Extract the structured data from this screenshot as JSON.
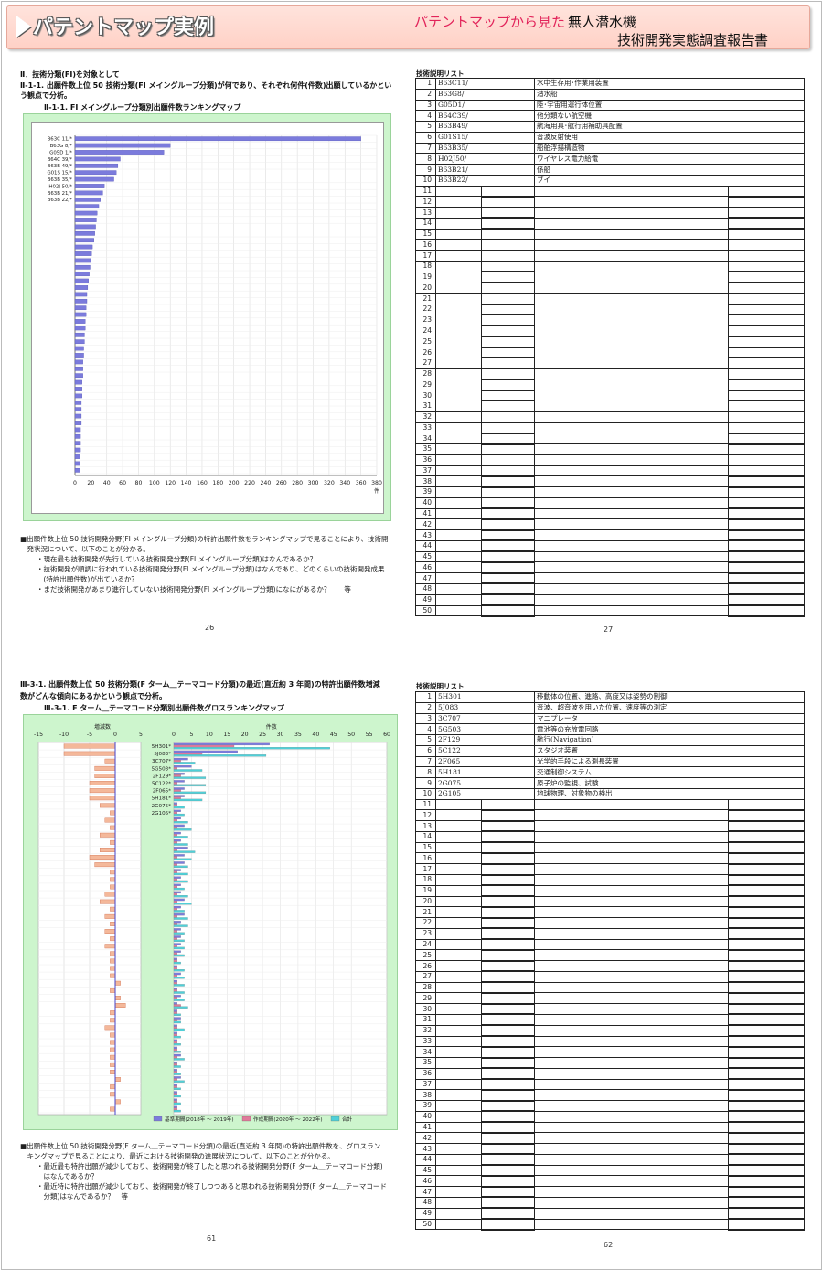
{
  "header": {
    "title": "パテントマップ実例",
    "subtitle_pink": "パテントマップから見た",
    "right_line1": "無人潜水機",
    "right_line2": "技術開発実態調査報告書"
  },
  "top_left": {
    "heading1": "Ⅱ．技術分類(FI)を対象として",
    "heading2_line1": "Ⅱ-1-1. 出願件数上位 50 技術分類(FI メイングループ分類)が何であり、それぞれ何件(件数)出願しているかとい",
    "heading2_line2": "う観点で分析。",
    "chart_caption": "Ⅱ-1-1. FI メイングループ分類別出願件数ランキングマップ",
    "note_lines": [
      "■出願件数上位 50 技術開発分野(FI メイングループ分類)の特許出願件数をランキングマップで見ることにより、技術開",
      "　発状況について、以下のことが分かる。",
      "・現在最も技術開発が先行している技術開発分野(FI メイングループ分類)はなんであるか？",
      "・技術開発が順調に行われている技術開発分野(FI メイングループ分類)はなんであり、どのくらいの技術開発成果",
      "　(特許出願件数)が出ているか？",
      "・まだ技術開発があまり進行していない技術開発分野(FI メイングループ分類)になにがあるか？　　等"
    ],
    "page": "26"
  },
  "top_right": {
    "label": "技術説明リスト",
    "rows": [
      {
        "no": "1",
        "code": "B63C11/",
        "desc": "水中生存用･作業用装置"
      },
      {
        "no": "2",
        "code": "B63G8/",
        "desc": "潜水船"
      },
      {
        "no": "3",
        "code": "G05D1/",
        "desc": "陸･宇宙用運行体位置"
      },
      {
        "no": "4",
        "code": "B64C39/",
        "desc": "他分類ない航空機"
      },
      {
        "no": "5",
        "code": "B63B49/",
        "desc": "航海用具･航行用補助具配置"
      },
      {
        "no": "6",
        "code": "G01S15/",
        "desc": "音波反射使用"
      },
      {
        "no": "7",
        "code": "B63B35/",
        "desc": "船舶浮揚構造物"
      },
      {
        "no": "8",
        "code": "H02J50/",
        "desc": "ワイヤレス電力給電"
      },
      {
        "no": "9",
        "code": "B63B21/",
        "desc": "係船"
      },
      {
        "no": "10",
        "code": "B63B22/",
        "desc": "ブイ"
      }
    ],
    "page": "27"
  },
  "bottom_left": {
    "heading_line1": "Ⅲ-3-1. 出願件数上位 50 技術分類(F ターム＿テーマコード分類)の最近(直近約 3 年間)の特許出願件数増減",
    "heading_line2": "数がどんな傾向にあるかという観点で分析。",
    "chart_caption": "Ⅲ-3-1. F ターム＿テーマコード分類別出願件数グロスランキングマップ",
    "note_lines": [
      "■出願件数上位 50 技術開発分野(F ターム＿テーマコード分類)の最近(直近約 3 年間)の特許出願件数を、グロスラン",
      "　キングマップで見ることにより、最近における技術開発の進展状況について、以下のことが分かる。",
      "・最近最も特許出願が減少しており、技術開発が終了したと思われる技術開発分野(F ターム＿テーマコード分類)",
      "　はなんであるか？",
      "・最近特に特許出願が減少しており、技術開発が終了しつつあると思われる技術開発分野(F ターム＿テーマコード",
      "　分類)はなんであるか？　等"
    ],
    "page": "61"
  },
  "bottom_right": {
    "label": "技術説明リスト",
    "rows": [
      {
        "no": "1",
        "code": "5H301",
        "desc": "移動体の位置、進路、高度又は姿勢の制御"
      },
      {
        "no": "2",
        "code": "5J083",
        "desc": "音波、超音波を用いた位置、速度等の測定"
      },
      {
        "no": "3",
        "code": "3C707",
        "desc": "マニプレータ"
      },
      {
        "no": "4",
        "code": "5G503",
        "desc": "電池等の充放電回路"
      },
      {
        "no": "5",
        "code": "2F129",
        "desc": "航行(Navigation)"
      },
      {
        "no": "6",
        "code": "5C122",
        "desc": "スタジオ装置"
      },
      {
        "no": "7",
        "code": "2F065",
        "desc": "光学的手段による測長装置"
      },
      {
        "no": "8",
        "code": "5H181",
        "desc": "交通制御システム"
      },
      {
        "no": "9",
        "code": "2G075",
        "desc": "原子炉の監視、試験"
      },
      {
        "no": "10",
        "code": "2G105",
        "desc": "地球物理、対象物の検出"
      }
    ],
    "page": "62"
  },
  "chart_data": [
    {
      "type": "bar",
      "orientation": "horizontal",
      "categories": [
        "B63C 11/*",
        "B63G 8/*",
        "G05D 1/*",
        "B64C 39/*",
        "B63B 49/*",
        "G01S 15/*",
        "B63B 35/*",
        "H02J 50/*",
        "B63B 21/*",
        "B63B 22/*"
      ],
      "values": [
        360,
        120,
        112,
        57,
        54,
        52,
        49,
        37,
        35,
        32,
        30,
        28,
        27,
        26,
        25,
        24,
        22,
        21,
        20,
        19,
        18,
        17,
        16,
        15,
        15,
        14,
        14,
        13,
        13,
        12,
        12,
        11,
        11,
        10,
        10,
        10,
        9,
        9,
        9,
        8,
        8,
        8,
        8,
        7,
        7,
        7,
        7,
        6,
        6,
        6
      ],
      "unit": "件",
      "xlim": [
        0,
        380
      ],
      "xticks": [
        0,
        20,
        40,
        60,
        80,
        100,
        120,
        140,
        160,
        180,
        200,
        220,
        240,
        260,
        280,
        300,
        320,
        340,
        360,
        380
      ],
      "grid": true,
      "color": "#7b7bdc"
    },
    {
      "type": "bar",
      "orientation": "horizontal",
      "categories": [
        "5H301*",
        "5J083*",
        "3C707*",
        "5G503*",
        "2F129*",
        "5C122*",
        "2F065*",
        "5H181*",
        "2G075*",
        "2G105*"
      ],
      "left_axis_label": "増減数",
      "left_xlim": [
        -15,
        5
      ],
      "left_xticks": [
        -15,
        -10,
        -5,
        0,
        5
      ],
      "diff": [
        -10,
        -10,
        -2,
        -4,
        -4,
        -5,
        -5,
        -5,
        -3,
        -1,
        -2,
        -1,
        -3,
        -1,
        -3,
        -5,
        -4,
        -1,
        -1,
        -1,
        -2,
        -3,
        -1,
        -2,
        -1,
        -2,
        -1,
        -2,
        -1,
        -1,
        -1,
        -1,
        1,
        -1,
        1,
        2,
        -1,
        -1,
        -2,
        -1,
        -1,
        -1,
        -1,
        -1,
        -1,
        1,
        -1,
        -1,
        1,
        -1
      ],
      "right_axis_label": "件数",
      "right_xlim": [
        0,
        60
      ],
      "right_xticks": [
        0,
        5,
        10,
        15,
        20,
        25,
        30,
        35,
        40,
        45,
        50,
        55,
        60
      ],
      "series": [
        {
          "name": "基準期間(2018年 ～ 2019年)",
          "color": "#7b7bdc",
          "values": [
            27,
            18,
            4,
            5,
            3,
            3,
            3,
            3,
            1,
            2,
            2,
            3,
            2,
            2,
            4,
            3,
            3,
            2,
            2,
            2,
            2,
            3,
            2,
            3,
            2,
            2,
            2,
            2,
            2,
            1,
            1,
            2,
            1,
            1,
            2,
            1,
            1,
            2,
            1,
            1,
            1,
            1,
            2,
            1,
            1,
            2,
            1,
            1,
            1,
            1
          ]
        },
        {
          "name": "作成期間(2020年 ～ 2022年)",
          "color": "#e07a9a",
          "values": [
            17,
            8,
            2,
            1,
            2,
            1,
            2,
            2,
            1,
            1,
            1,
            1,
            1,
            1,
            1,
            1,
            1,
            1,
            1,
            1,
            1,
            1,
            1,
            1,
            1,
            1,
            1,
            1,
            1,
            1,
            1,
            1,
            1,
            1,
            1,
            2,
            1,
            1,
            1,
            1,
            1,
            1,
            1,
            1,
            1,
            1,
            1,
            1,
            1,
            1
          ]
        },
        {
          "name": "合計",
          "color": "#4fd0d8",
          "values": [
            44,
            26,
            6,
            8,
            9,
            9,
            9,
            8,
            3,
            3,
            4,
            5,
            4,
            4,
            6,
            5,
            4,
            4,
            4,
            3,
            4,
            5,
            3,
            4,
            4,
            3,
            3,
            3,
            3,
            2,
            3,
            3,
            3,
            3,
            3,
            4,
            2,
            2,
            3,
            2,
            2,
            2,
            3,
            2,
            2,
            3,
            2,
            2,
            2,
            2
          ]
        }
      ],
      "grid": true,
      "legend_position": "bottom-right"
    }
  ]
}
